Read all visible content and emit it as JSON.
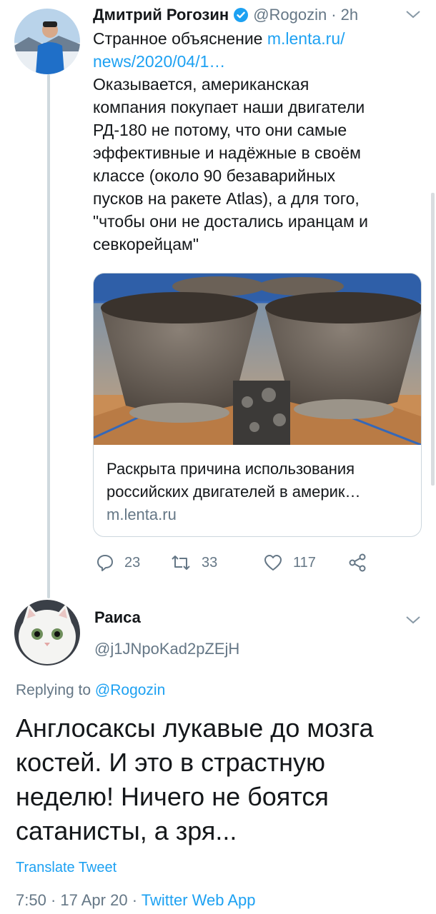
{
  "original_tweet": {
    "author_name": "Дмитрий Рогозин",
    "author_handle": "@Rogozin",
    "separator": "·",
    "time": "2h",
    "text_prefix": "Странное объяснение ",
    "link_line1": "m.lenta.ru/",
    "link_line2": "news/2020/04/1…",
    "body_lines": [
      "Оказывается,  американская",
      "компания покупает наши двигатели",
      "РД-180 не потому, что они самые",
      "эффективные и надёжные в своём",
      "классе (около 90 безаварийных",
      "пусков на ракете Atlas), а для того,",
      "\"чтобы они не достались иранцам и",
      "севкорейцам\""
    ],
    "card": {
      "title_line1": "Раскрыта причина использования",
      "title_line2": "российских двигателей в америк…",
      "domain": "m.lenta.ru"
    },
    "actions": {
      "replies": "23",
      "retweets": "33",
      "likes": "117"
    }
  },
  "reply": {
    "author_name": "Раиса",
    "author_handle": "@j1JNpoKad2pZEjH",
    "replying_to_label": "Replying to ",
    "replying_to_handle": "@Rogozin",
    "text_lines": [
      "Англосаксы лукавые до мозга",
      "костей. И это в страстную",
      "неделю! Ничего не боятся",
      "сатанисты, а зря..."
    ],
    "translate_label": "Translate Tweet",
    "time": "7:50",
    "date": "17 Apr 20",
    "source": "Twitter Web App",
    "meta_sep": " · "
  },
  "colors": {
    "accent": "#1da1f2",
    "muted": "#657786",
    "text": "#14171a",
    "border": "#ccd6dd"
  }
}
